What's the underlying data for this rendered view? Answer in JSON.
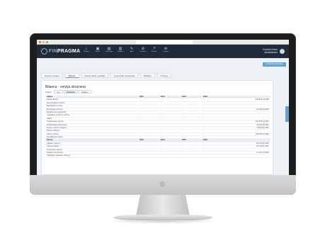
{
  "browser": {
    "url": ""
  },
  "header": {
    "logo_prefix": "FIN",
    "logo_brand": "PRAGMA",
    "nav": [
      {
        "icon": "home-icon",
        "glyph": "⌂",
        "label": "Početna"
      },
      {
        "icon": "clients-icon",
        "glyph": "▣",
        "label": "Klijenti"
      },
      {
        "icon": "new-client-icon",
        "glyph": "▤",
        "label": "Novi klijent"
      },
      {
        "icon": "analysis-icon",
        "glyph": "▥",
        "label": "Analiza"
      },
      {
        "icon": "tools-icon",
        "glyph": "✎",
        "label": "Alati"
      },
      {
        "icon": "settings-icon",
        "glyph": "⚙",
        "label": "Postavke"
      },
      {
        "icon": "help-icon",
        "glyph": "?",
        "label": "Pomoć"
      },
      {
        "icon": "contact-icon",
        "glyph": "✉",
        "label": "Kontakt"
      }
    ],
    "user_name": "Korisnik Demo",
    "user_role": "Administrator"
  },
  "content": {
    "action_button": "IZVJEŠTAJ BILANCA",
    "tabs": [
      {
        "icon": "doc-icon",
        "label": "Osnovni podaci",
        "active": false
      },
      {
        "icon": "table-icon",
        "label": "Bilanca",
        "active": true
      },
      {
        "icon": "chart-icon",
        "label": "Račun dobiti i gubitka",
        "active": false
      },
      {
        "icon": "info-icon",
        "label": "Financijski pokazatelji",
        "active": false
      },
      {
        "icon": "note-icon",
        "label": "Bilješke",
        "active": false
      },
      {
        "icon": "clock-icon",
        "label": "Povijest",
        "active": false
      }
    ],
    "panel_title": "Bilanca - verzija skraćena",
    "toolbar_label": "Prikaz:",
    "toolbar_buttons": [
      {
        "label": "sve",
        "active": false
      },
      {
        "label": "skraćeno",
        "active": true
      },
      {
        "label": "detaljno",
        "active": false
      }
    ],
    "table": {
      "headers": [
        "Aktiva",
        "2013",
        "2014",
        "2015",
        "2016",
        ""
      ],
      "rows": [
        [
          "Aktiva ukupno",
          "-",
          "-",
          "-",
          "-",
          "135.345,12 HRK"
        ],
        [
          "Nematerijalna imovina",
          "-",
          "-",
          "-",
          "-",
          "-"
        ],
        [
          "Materijalna imovina",
          "-",
          "-",
          "-",
          "-",
          "-"
        ],
        [
          "Financijska imovina",
          "-",
          "-",
          "-",
          "-",
          "12.300,00 HRK"
        ],
        [
          "Potraživanja dugoročna",
          "-",
          "-",
          "-",
          "-",
          "-"
        ],
        [
          "Odgođena porezna imovina",
          "-",
          "-",
          "-",
          "-",
          "-"
        ],
        [
          "Zalihe",
          "-",
          "-",
          "-",
          "-",
          "-"
        ],
        [
          "Kratkotrajna imovina",
          "-",
          "-",
          "-",
          "-",
          "122.045,12 HRK"
        ],
        [
          "Potraživanja kratkoročna",
          "-",
          "-",
          "-",
          "-",
          "45.210,30 HRK"
        ],
        [
          "Novac u banci i blagajni",
          "-",
          "-",
          "-",
          "-",
          "76.834,82 HRK"
        ],
        [
          "Plaćeni troškovi",
          "-",
          "-",
          "-",
          "-",
          "-"
        ],
        [
          "Ukupno aktiva",
          "-",
          "-",
          "-",
          "-",
          "135.345,12 HRK"
        ],
        [
          "Izvanbilančni zapisi",
          "-",
          "-",
          "-",
          "-",
          "-"
        ]
      ],
      "headers2": [
        "Pasiva",
        "2013",
        "2014",
        "2015",
        "2016",
        ""
      ],
      "rows2": [
        [
          "Kapital i rezerve",
          "-",
          "-",
          "-",
          "-",
          "98.120,40 HRK"
        ],
        [
          "Upisani kapital",
          "-",
          "-",
          "-",
          "-",
          "20.000,00 HRK"
        ],
        [
          "Dugoročne obveze",
          "-",
          "-",
          "-",
          "-",
          "-"
        ],
        [
          "Kratkoročne obveze",
          "-",
          "-",
          "-",
          "-",
          "37.224,72 HRK"
        ],
        [
          "Odgođeno plaćanje troškova",
          "-",
          "-",
          "-",
          "-",
          "-"
        ]
      ]
    }
  },
  "colors": {
    "header_bg": "#1f2b3a",
    "accent": "#5ea3d6",
    "content_bg": "#eef1f4"
  }
}
